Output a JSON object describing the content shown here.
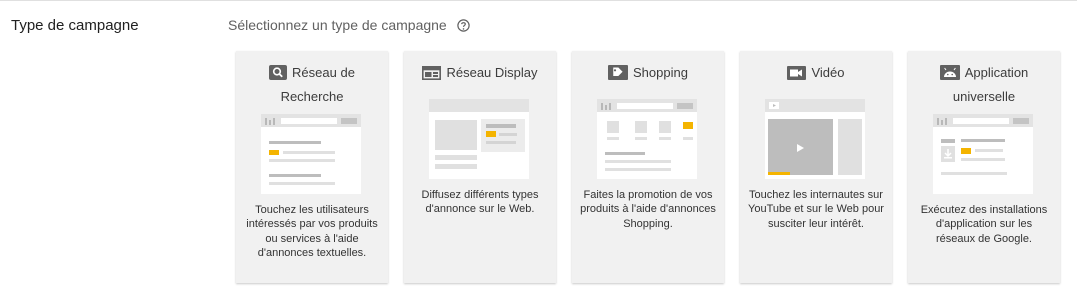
{
  "section_label": "Type de campagne",
  "prompt": "Sélectionnez un type de campagne",
  "colors": {
    "accent": "#f4b400",
    "card_bg": "#f1f1f1",
    "icon_gray": "#616161"
  },
  "cards": [
    {
      "icon": "search-icon",
      "title": "Réseau de Recherche",
      "description": "Touchez les utilisateurs intéressés par vos produits ou services à l'aide d'annonces textuelles."
    },
    {
      "icon": "display-icon",
      "title": "Réseau Display",
      "description": "Diffusez différents types d'annonce sur le Web."
    },
    {
      "icon": "tag-icon",
      "title": "Shopping",
      "description": "Faites la promotion de vos produits à l'aide d'annonces Shopping."
    },
    {
      "icon": "video-camera-icon",
      "title": "Vidéo",
      "description": "Touchez les internautes sur YouTube et sur le Web pour susciter leur intérêt."
    },
    {
      "icon": "android-icon",
      "title": "Application universelle",
      "description": "Exécutez des installations d'application sur les réseaux de Google."
    }
  ]
}
